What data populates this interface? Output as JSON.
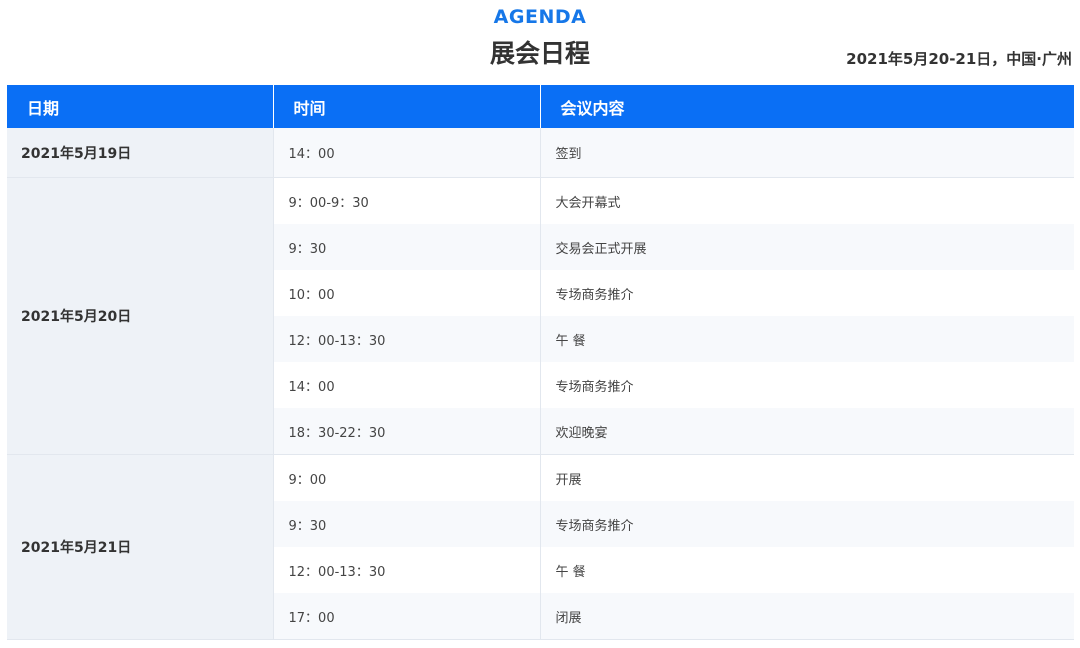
{
  "header": {
    "agenda_label": "AGENDA",
    "title": "展会日程",
    "event_info": "2021年5月20-21日，中国·广州"
  },
  "table": {
    "columns": [
      "日期",
      "时间",
      "会议内容"
    ],
    "groups": [
      {
        "date": "2021年5月19日",
        "rows": [
          {
            "time": "14：00",
            "content": "签到"
          }
        ]
      },
      {
        "date": "2021年5月20日",
        "rows": [
          {
            "time": "9：00-9：30",
            "content": "大会开幕式"
          },
          {
            "time": "9：30",
            "content": "交易会正式开展"
          },
          {
            "time": "10：00",
            "content": "专场商务推介"
          },
          {
            "time": "12：00-13：30",
            "content": "午 餐"
          },
          {
            "time": "14：00",
            "content": "专场商务推介"
          },
          {
            "time": "18：30-22：30",
            "content": "欢迎晚宴"
          }
        ]
      },
      {
        "date": "2021年5月21日",
        "rows": [
          {
            "time": "9：00",
            "content": "开展"
          },
          {
            "time": "9：30",
            "content": "专场商务推介"
          },
          {
            "time": "12：00-13：30",
            "content": "午 餐"
          },
          {
            "time": "17：00",
            "content": "闭展"
          }
        ]
      }
    ]
  },
  "colors": {
    "accent": "#1677e8",
    "header_bg": "#0a6ff5",
    "date_bg": "#eef2f7"
  }
}
